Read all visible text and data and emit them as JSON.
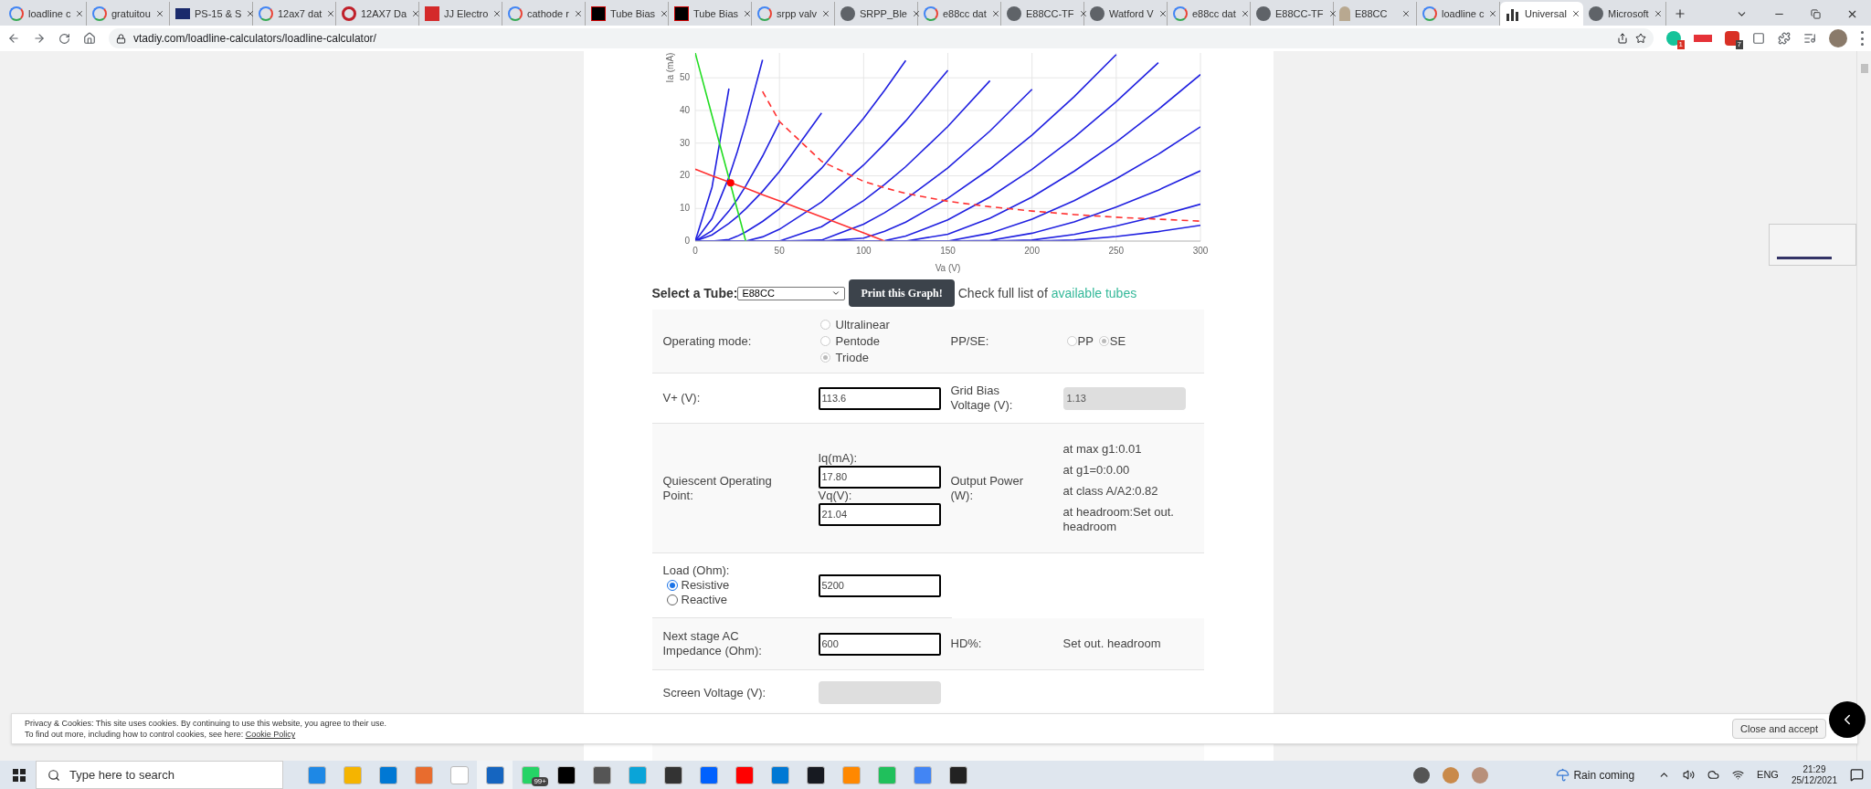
{
  "browser": {
    "tabs": [
      {
        "title": "loadline c",
        "kind": "google",
        "selected": false
      },
      {
        "title": "gratuitou",
        "kind": "google",
        "selected": false
      },
      {
        "title": "PS-15 & S",
        "kind": "tcj",
        "selected": false
      },
      {
        "title": "12ax7 dat",
        "kind": "google",
        "selected": false
      },
      {
        "title": "12AX7 Da",
        "kind": "ring",
        "selected": false
      },
      {
        "title": "JJ Electro",
        "kind": "jj",
        "selected": false
      },
      {
        "title": "cathode r",
        "kind": "google",
        "selected": false
      },
      {
        "title": "Tube Bias",
        "kind": "rr",
        "selected": false
      },
      {
        "title": "Tube Bias",
        "kind": "rr",
        "selected": false
      },
      {
        "title": "srpp valv",
        "kind": "google",
        "selected": false
      },
      {
        "title": "SRPP_Ble",
        "kind": "globe",
        "selected": false
      },
      {
        "title": "e88cc dat",
        "kind": "google",
        "selected": false
      },
      {
        "title": "E88CC-TF",
        "kind": "globe",
        "selected": false
      },
      {
        "title": "Watford V",
        "kind": "globe",
        "selected": false
      },
      {
        "title": "e88cc dat",
        "kind": "google",
        "selected": false
      },
      {
        "title": "E88CC-TF",
        "kind": "globe",
        "selected": false
      },
      {
        "title": "E88CC",
        "kind": "tube",
        "selected": false
      },
      {
        "title": "loadline c",
        "kind": "google",
        "selected": false
      },
      {
        "title": "Universal",
        "kind": "bars",
        "selected": true
      },
      {
        "title": "Microsoft",
        "kind": "globe",
        "selected": false
      }
    ],
    "url": "vtadiy.com/loadline-calculators/loadline-calculator/",
    "extension_badges": [
      "1",
      "7"
    ]
  },
  "chart": {
    "chart_data": {
      "type": "line",
      "xlabel": "Va (V)",
      "ylabel": "Ia (mA)",
      "grid": true,
      "x": [
        0,
        10,
        20,
        25,
        30,
        40,
        50,
        75,
        100,
        112.5,
        125,
        150,
        175,
        200,
        225,
        250,
        275,
        300
      ],
      "xlim": [
        0,
        300
      ],
      "ylim": [
        0,
        57.6
      ],
      "xticks": [
        0,
        50,
        100,
        150,
        200,
        250,
        300
      ],
      "yticks": [
        0,
        10,
        20,
        30,
        40,
        50
      ],
      "series": [
        {
          "color": "#2020e0",
          "values": [
            0,
            16.5,
            46.7,
            null,
            null,
            null,
            null,
            null,
            null,
            null,
            null,
            null,
            null,
            null,
            null,
            null,
            null,
            null
          ]
        },
        {
          "color": "#2020e0",
          "values": [
            0,
            6.9,
            19.6,
            27.4,
            36.1,
            55.5,
            null,
            null,
            null,
            null,
            null,
            null,
            null,
            null,
            null,
            null,
            null,
            null
          ]
        },
        {
          "color": "#2020e0",
          "values": [
            0,
            3.2,
            9.2,
            12.8,
            16.9,
            26.0,
            36.3,
            null,
            null,
            null,
            null,
            null,
            null,
            null,
            null,
            null,
            null,
            null
          ]
        },
        {
          "color": "#2020e0",
          "values": [
            0,
            1.9,
            5.4,
            7.5,
            9.9,
            15.2,
            21.3,
            39.2,
            null,
            null,
            null,
            null,
            null,
            null,
            null,
            null,
            null,
            null
          ]
        },
        {
          "color": "#2020e0",
          "values": [
            0,
            0,
            0.5,
            1.5,
            2.8,
            6.0,
            9.9,
            22.3,
            37.6,
            46.2,
            55.3,
            null,
            null,
            null,
            null,
            null,
            null,
            null
          ]
        },
        {
          "color": "#2020e0",
          "values": [
            0,
            0,
            0,
            0,
            0,
            1.3,
            3.6,
            12.0,
            23.3,
            29.8,
            36.8,
            52.3,
            null,
            null,
            null,
            null,
            null,
            null
          ]
        },
        {
          "color": "#2020e0",
          "values": [
            0,
            0,
            0,
            0,
            0,
            0,
            0,
            4.4,
            12.4,
            17.4,
            22.8,
            35.1,
            49.1,
            null,
            null,
            null,
            null,
            null
          ]
        },
        {
          "color": "#2020e0",
          "values": [
            0,
            0,
            0,
            0,
            0,
            0,
            0,
            0.3,
            5.2,
            8.7,
            12.8,
            22.4,
            33.7,
            46.5,
            null,
            null,
            null,
            null
          ]
        },
        {
          "color": "#2020e0",
          "values": [
            0,
            0,
            0,
            0,
            0,
            0,
            0,
            0,
            0.9,
            3.0,
            5.8,
            13.1,
            22.1,
            32.5,
            44.2,
            57.1,
            null,
            null
          ]
        },
        {
          "color": "#2020e0",
          "values": [
            0,
            0,
            0,
            0,
            0,
            0,
            0,
            0,
            0,
            0.1,
            1.5,
            6.5,
            13.5,
            22.0,
            31.8,
            42.7,
            54.6,
            null
          ]
        },
        {
          "color": "#2020e0",
          "values": [
            0,
            0,
            0,
            0,
            0,
            0,
            0,
            0,
            0,
            0,
            0,
            2.1,
            7.0,
            13.5,
            21.4,
            30.3,
            40.3,
            51.0
          ]
        },
        {
          "color": "#2020e0",
          "values": [
            0,
            0,
            0,
            0,
            0,
            0,
            0,
            0,
            0,
            0,
            0,
            0,
            2.4,
            6.7,
            12.4,
            19.1,
            26.6,
            35.0
          ]
        },
        {
          "color": "#2020e0",
          "values": [
            0,
            0,
            0,
            0,
            0,
            0,
            0,
            0,
            0,
            0,
            0,
            0,
            0.2,
            2.4,
            5.9,
            10.4,
            15.6,
            21.5
          ]
        },
        {
          "color": "#2020e0",
          "values": [
            0,
            0,
            0,
            0,
            0,
            0,
            0,
            0,
            0,
            0,
            0,
            0,
            0,
            0.3,
            2.0,
            4.6,
            7.7,
            11.3
          ]
        },
        {
          "color": "#2020e0",
          "values": [
            0,
            0,
            0,
            0,
            0,
            0,
            0,
            0,
            0,
            0,
            0,
            0,
            0,
            0,
            0.3,
            1.4,
            2.9,
            4.8
          ]
        },
        {
          "color": "#22dd22",
          "values": [
            57.6,
            38.4,
            19.2,
            9.6,
            0,
            null,
            null,
            null,
            null,
            null,
            null,
            null,
            null,
            null,
            null,
            null,
            null,
            null
          ]
        },
        {
          "color": "#ff3030",
          "values": [
            22,
            20.0,
            18.1,
            17.1,
            16.2,
            14.2,
            12.3,
            7.4,
            2.5,
            0,
            null,
            null,
            null,
            null,
            null,
            null,
            null,
            null
          ]
        },
        {
          "color": "#ff3030",
          "line_style": "dashed",
          "values": [
            null,
            null,
            null,
            null,
            null,
            45.8,
            36.6,
            24.4,
            18.3,
            16.3,
            14.6,
            12.2,
            10.5,
            9.2,
            8.1,
            7.3,
            6.7,
            6.1
          ]
        }
      ]
    }
  },
  "tube_select": {
    "label": "Select a Tube:",
    "value": "E88CC",
    "button": "Print this Graph!",
    "note": "Check full list of",
    "link": "available tubes"
  },
  "form": {
    "operating_mode": {
      "label": "Operating mode:",
      "disabled": true,
      "options": [
        {
          "label": "Ultralinear",
          "selected": false
        },
        {
          "label": "Pentode",
          "selected": false
        },
        {
          "label": "Triode",
          "selected": true
        }
      ]
    },
    "pp_se": {
      "label": "PP/SE:",
      "disabled": true,
      "options": [
        {
          "label": "PP",
          "selected": false
        },
        {
          "label": "SE",
          "selected": true
        }
      ]
    },
    "v_plus": {
      "label": "V+ (V):",
      "value": "113.6"
    },
    "grid_bias": {
      "label": "Grid Bias Voltage (V):",
      "value": "1.13",
      "disabled": true
    },
    "quiescent": {
      "label": "Quiescent Operating Point:",
      "fields": [
        {
          "label": "Iq(mA):",
          "value": "17.80"
        },
        {
          "label": "Vq(V):",
          "value": "21.04"
        }
      ]
    },
    "output_power": {
      "label": "Output Power (W):",
      "lines": [
        "at max g1:0.01",
        "at g1=0:0.00",
        "at class A/A2:0.82",
        "at headroom:Set out. headroom"
      ]
    },
    "load": {
      "label": "Load (Ohm):",
      "value": "5200",
      "options": [
        {
          "label": "Resistive",
          "selected": true
        },
        {
          "label": "Reactive",
          "selected": false
        }
      ]
    },
    "next_stage": {
      "label": "Next stage AC Impedance (Ohm):",
      "value": "600"
    },
    "hd": {
      "label": "HD%:",
      "value": "Set out. headroom"
    },
    "screen_voltage": {
      "label": "Screen Voltage (V):",
      "disabled": true
    }
  },
  "cookie_banner": {
    "text": "Privacy & Cookies: This site uses cookies. By continuing to use this website, you agree to their use.",
    "text2": "To find out more, including how to control cookies, see here:",
    "link": "Cookie Policy",
    "button": "Close and accept"
  },
  "taskbar": {
    "search_placeholder": "Type here to search",
    "mail_badge": "99+",
    "weather": "Rain coming",
    "language": "ENG",
    "time": "21:29",
    "date": "25/12/2021"
  }
}
